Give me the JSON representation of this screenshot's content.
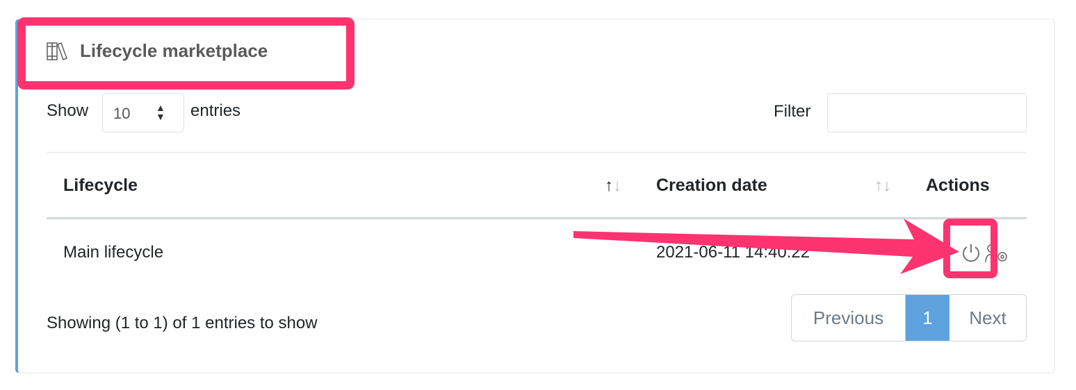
{
  "header": {
    "title": "Lifecycle marketplace",
    "icon": "books-icon"
  },
  "length": {
    "show_label": "Show",
    "value": "10",
    "entries_label": "entries"
  },
  "filter": {
    "label": "Filter",
    "value": ""
  },
  "table": {
    "columns": [
      "Lifecycle",
      "Creation date",
      "Actions"
    ],
    "rows": [
      {
        "lifecycle": "Main lifecycle",
        "creation_date": "2021-06-11 14:40:22",
        "actions": [
          "power-icon",
          "user-settings-icon"
        ]
      }
    ]
  },
  "footer": {
    "info": "Showing (1 to 1) of 1 entries to show"
  },
  "pagination": {
    "previous": "Previous",
    "current": "1",
    "next": "Next"
  },
  "colors": {
    "accent": "#5fa3de",
    "annotation": "#ff3370"
  }
}
